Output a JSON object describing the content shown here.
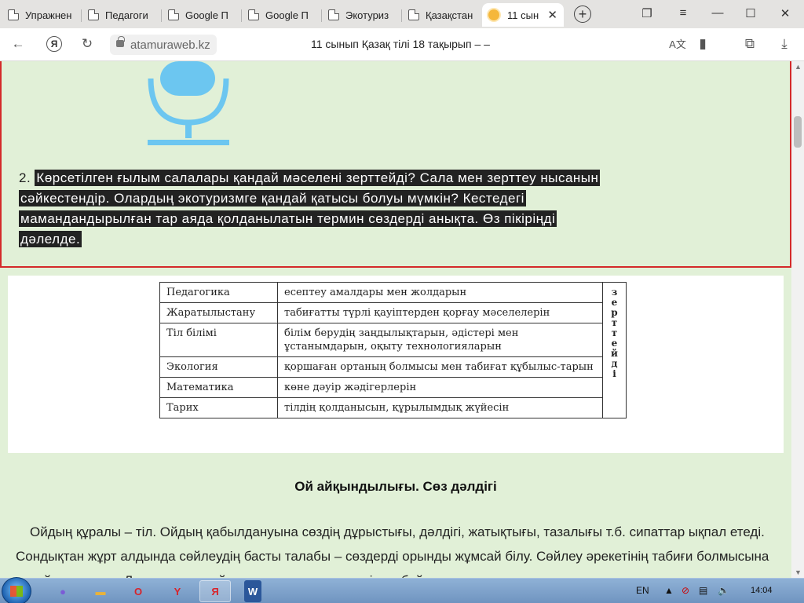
{
  "browser": {
    "tabs": [
      {
        "label": "Упражнен"
      },
      {
        "label": "Педагоги"
      },
      {
        "label": "Google П"
      },
      {
        "label": "Google П"
      },
      {
        "label": "Экотуриз"
      },
      {
        "label": "Қазақстан"
      },
      {
        "label": "11 сын",
        "active": true
      }
    ],
    "url": "atamuraweb.kz",
    "page_title": "11 сынып Қазақ тілі 18 тақырып – –"
  },
  "task": {
    "number": "2.",
    "text_lines": [
      "Көрсетілген ғылым салалары қандай мәселені зерттейді? Сала мен зерттеу нысанын",
      "сәйкестендір. Олардың экотуризмге қандай қатысы болуы мүмкін? Кестедегі",
      "мамандандырылған тар аяда қолданылатын термин сөздерді анықта. Өз пікіріңді",
      "дәлелде."
    ]
  },
  "table": {
    "rows": [
      {
        "science": "Педагогика",
        "object": "есептеу амалдары мен жолдарын"
      },
      {
        "science": "Жаратылыстану",
        "object": "табиғатты түрлі қауіптерден қорғау мәселелерін"
      },
      {
        "science": "Тіл білімі",
        "object": "білім берудің заңдылықтарын, әдістері мен ұстанымдарын, оқыту технологияларын"
      },
      {
        "science": "Экология",
        "object": "қоршаған ортаның болмысы мен табиғат құбылыс-тарын"
      },
      {
        "science": "Математика",
        "object": "көне дәуір жәдігерлерін"
      },
      {
        "science": "Тарих",
        "object": "тілдің қолданысын, құрылымдық жүйесін"
      }
    ],
    "side_word": "зерттейді"
  },
  "section": {
    "heading": "Ой айқындылығы. Сөз дәлдігі",
    "paragraph": "Ойдың құралы – тіл. Ойдың қабылдануына сөздің дұрыстығы, дәлдігі, жатықтығы, тазалығы т.б. сипаттар ықпал етеді. Сондықтан жұрт алдында сөйлеудің басты талабы – сөздерді орынды жұмсай білу. Сөйлеу әрекетінің табиғи болмысына қарай сан алуан. Логикамен өз ойы мен көзқарасын жеткізуге байланысты"
  },
  "taskbar": {
    "lang": "EN",
    "time": "14:04"
  },
  "colors": {
    "page_bg": "#e1f0d7",
    "task_border": "#d42a2a",
    "mic": "#6cc6f0",
    "highlight": "#222222"
  }
}
